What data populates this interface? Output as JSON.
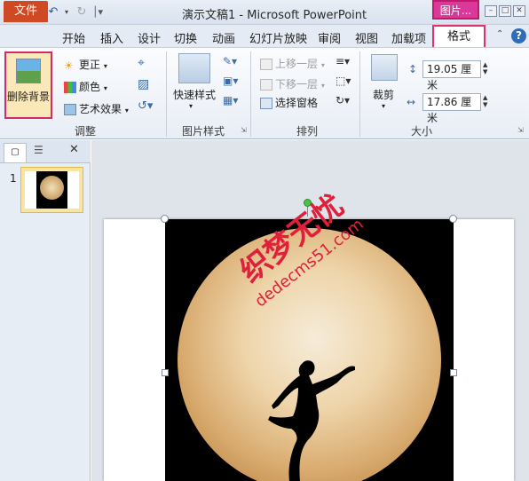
{
  "titlebar": {
    "app_icon_letter": "P",
    "document_title": "演示文稿1 - Microsoft PowerPoint",
    "context_tab_title": "图片..."
  },
  "tabs": {
    "file": "文件",
    "items": [
      "开始",
      "插入",
      "设计",
      "切换",
      "动画",
      "幻灯片放映",
      "审阅",
      "视图",
      "加载项"
    ],
    "format": "格式"
  },
  "ribbon": {
    "adjust": {
      "remove_background": "删除背景",
      "corrections": "更正",
      "color": "颜色",
      "artistic_effects": "艺术效果",
      "group_label": "调整"
    },
    "picture_styles": {
      "quick_styles": "快速样式",
      "group_label": "图片样式"
    },
    "arrange": {
      "bring_forward": "上移一层",
      "send_backward": "下移一层",
      "selection_pane": "选择窗格",
      "group_label": "排列"
    },
    "size": {
      "crop": "裁剪",
      "height_value": "19.05 厘米",
      "width_value": "17.86 厘米",
      "group_label": "大小"
    }
  },
  "slides_pane": {
    "slide_number": "1"
  },
  "watermark": {
    "line1": "织梦无忧",
    "line2": "dedecms51.com"
  },
  "colors": {
    "file_tab": "#cf4a24",
    "context_tab": "#d93a9a",
    "highlight_border": "#d52a6a"
  }
}
